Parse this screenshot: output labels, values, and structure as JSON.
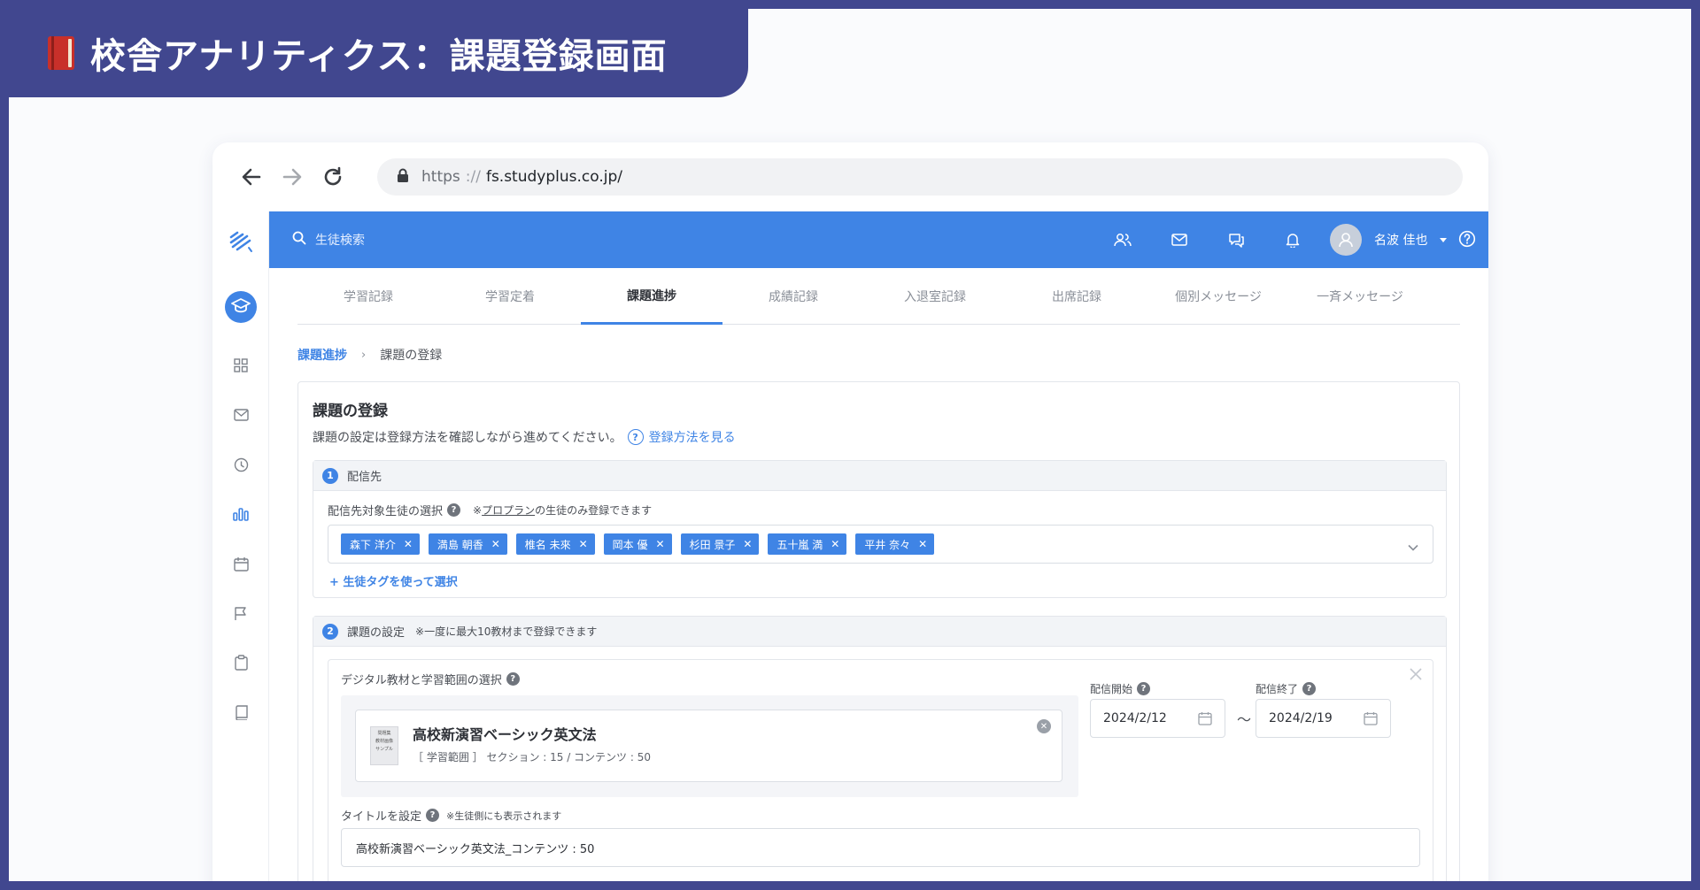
{
  "slide": {
    "title": "校舎アナリティクス：課題登録画面"
  },
  "browser": {
    "url_scheme": "https",
    "url_separator": "://",
    "url_host": "fs.studyplus.co.jp/"
  },
  "topbar": {
    "search_placeholder": "生徒検索",
    "user_name": "名波 佳也"
  },
  "tabs": [
    {
      "label": "学習記録",
      "active": false
    },
    {
      "label": "学習定着",
      "active": false
    },
    {
      "label": "課題進捗",
      "active": true
    },
    {
      "label": "成績記録",
      "active": false
    },
    {
      "label": "入退室記録",
      "active": false
    },
    {
      "label": "出席記録",
      "active": false
    },
    {
      "label": "個別メッセージ",
      "active": false
    },
    {
      "label": "一斉メッセージ",
      "active": false
    }
  ],
  "breadcrumb": {
    "parent": "課題進捗",
    "separator": "›",
    "current": "課題の登録"
  },
  "form": {
    "title": "課題の登録",
    "description": "課題の設定は登録方法を確認しながら進めてください。",
    "help_link": "登録方法を見る",
    "section1": {
      "number": "1",
      "title": "配信先",
      "field_label": "配信先対象生徒の選択",
      "note_prefix": "※",
      "note_link": "プロプラン",
      "note_suffix": "の生徒のみ登録できます",
      "students": [
        "森下 洋介",
        "満島 朝香",
        "椎名 未來",
        "岡本 優",
        "杉田 景子",
        "五十嵐 満",
        "平井 奈々"
      ],
      "tag_select_link": "+ 生徒タグを使って選択"
    },
    "section2": {
      "number": "2",
      "title": "課題の設定",
      "note": "※一度に最大10教材まで登録できます",
      "material_label": "デジタル教材と学習範囲の選択",
      "material": {
        "thumb_lines": [
          "問題集",
          "教材画像",
          "サンプル"
        ],
        "title": "高校新演習ベーシック英文法",
        "meta": "［ 学習範囲 ］ セクション : 15  /  コンテンツ : 50"
      },
      "start_label": "配信開始",
      "start_value": "2024/2/12",
      "end_label": "配信終了",
      "end_value": "2024/2/19",
      "range_separator": "〜",
      "title_label": "タイトルを設定",
      "title_note": "※生徒側にも表示されます",
      "title_value": "高校新演習ベーシック英文法_コンテンツ : 50"
    }
  }
}
